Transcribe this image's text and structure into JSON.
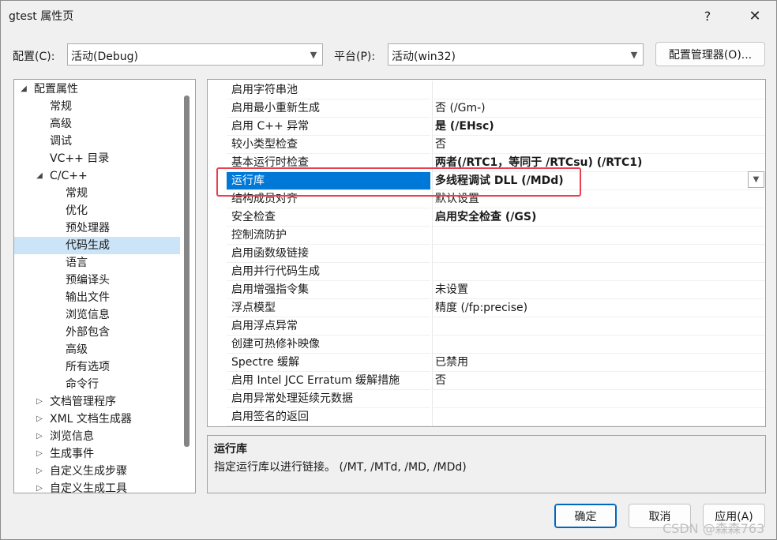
{
  "window": {
    "title": "gtest 属性页",
    "help_label": "?",
    "close_label": "✕"
  },
  "config": {
    "label": "配置(C):",
    "value": "活动(Debug)"
  },
  "platform": {
    "label": "平台(P):",
    "value": "活动(win32)"
  },
  "config_manager_label": "配置管理器(O)...",
  "tree": {
    "items": [
      {
        "label": "配置属性",
        "toggle": "◢",
        "level": 0
      },
      {
        "label": "常规",
        "toggle": "",
        "level": 1
      },
      {
        "label": "高级",
        "toggle": "",
        "level": 1
      },
      {
        "label": "调试",
        "toggle": "",
        "level": 1
      },
      {
        "label": "VC++ 目录",
        "toggle": "",
        "level": 1
      },
      {
        "label": "C/C++",
        "toggle": "◢",
        "level": 1
      },
      {
        "label": "常规",
        "toggle": "",
        "level": 2
      },
      {
        "label": "优化",
        "toggle": "",
        "level": 2
      },
      {
        "label": "预处理器",
        "toggle": "",
        "level": 2
      },
      {
        "label": "代码生成",
        "toggle": "",
        "level": 2
      },
      {
        "label": "语言",
        "toggle": "",
        "level": 2
      },
      {
        "label": "预编译头",
        "toggle": "",
        "level": 2
      },
      {
        "label": "输出文件",
        "toggle": "",
        "level": 2
      },
      {
        "label": "浏览信息",
        "toggle": "",
        "level": 2
      },
      {
        "label": "外部包含",
        "toggle": "",
        "level": 2
      },
      {
        "label": "高级",
        "toggle": "",
        "level": 2
      },
      {
        "label": "所有选项",
        "toggle": "",
        "level": 2
      },
      {
        "label": "命令行",
        "toggle": "",
        "level": 2
      },
      {
        "label": "文档管理程序",
        "toggle": "▷",
        "level": 1
      },
      {
        "label": "XML 文档生成器",
        "toggle": "▷",
        "level": 1
      },
      {
        "label": "浏览信息",
        "toggle": "▷",
        "level": 1
      },
      {
        "label": "生成事件",
        "toggle": "▷",
        "level": 1
      },
      {
        "label": "自定义生成步骤",
        "toggle": "▷",
        "level": 1
      },
      {
        "label": "自定义生成工具",
        "toggle": "▷",
        "level": 1
      }
    ]
  },
  "properties": [
    {
      "name": "启用字符串池",
      "value": ""
    },
    {
      "name": "启用最小重新生成",
      "value": "否 (/Gm-)"
    },
    {
      "name": "启用 C++ 异常",
      "value": "是 (/EHsc)"
    },
    {
      "name": "较小类型检查",
      "value": "否"
    },
    {
      "name": "基本运行时检查",
      "value": "两者(/RTC1，等同于 /RTCsu) (/RTC1)"
    },
    {
      "name": "运行库",
      "value": "多线程调试 DLL (/MDd)"
    },
    {
      "name": "结构成员对齐",
      "value": "默认设置"
    },
    {
      "name": "安全检查",
      "value": "启用安全检查 (/GS)"
    },
    {
      "name": "控制流防护",
      "value": ""
    },
    {
      "name": "启用函数级链接",
      "value": ""
    },
    {
      "name": "启用并行代码生成",
      "value": ""
    },
    {
      "name": "启用增强指令集",
      "value": "未设置"
    },
    {
      "name": "浮点模型",
      "value": "精度 (/fp:precise)"
    },
    {
      "name": "启用浮点异常",
      "value": ""
    },
    {
      "name": "创建可热修补映像",
      "value": ""
    },
    {
      "name": "Spectre 缓解",
      "value": "已禁用"
    },
    {
      "name": "启用 Intel JCC Erratum 缓解措施",
      "value": "否"
    },
    {
      "name": "启用异常处理延续元数据",
      "value": ""
    },
    {
      "name": "启用签名的返回",
      "value": ""
    }
  ],
  "description": {
    "title": "运行库",
    "text": "指定运行库以进行链接。    (/MT, /MTd, /MD, /MDd)"
  },
  "buttons": {
    "ok": "确定",
    "cancel": "取消",
    "apply": "应用(A)"
  },
  "watermark": "CSDN @森森763"
}
